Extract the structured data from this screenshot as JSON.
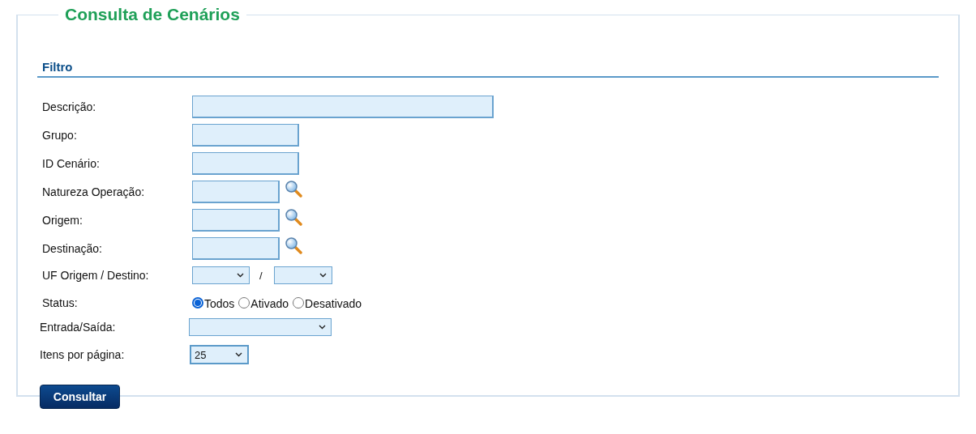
{
  "title": "Consulta de Cenários",
  "section": "Filtro",
  "fields": [
    {
      "kind": "wide-text",
      "label": "Descrição:"
    },
    {
      "kind": "text",
      "label": "Grupo:"
    },
    {
      "kind": "text",
      "label": "ID Cenário:"
    },
    {
      "kind": "lookup",
      "label": "Natureza Operação:"
    },
    {
      "kind": "lookup",
      "label": "Origem:"
    },
    {
      "kind": "lookup",
      "label": "Destinação:"
    },
    {
      "kind": "pair-select",
      "label": "UF Origem / Destino:",
      "separator": "/"
    },
    {
      "kind": "radio",
      "label": "Status:",
      "options": [
        {
          "label": "Todos",
          "selected": true
        },
        {
          "label": "Ativado",
          "selected": false
        },
        {
          "label": "Desativado",
          "selected": false
        }
      ]
    },
    {
      "kind": "wide-select",
      "label": "Entrada/Saída:"
    },
    {
      "kind": "select",
      "label": "Itens por página:",
      "value": "25"
    }
  ],
  "button": "Consultar"
}
